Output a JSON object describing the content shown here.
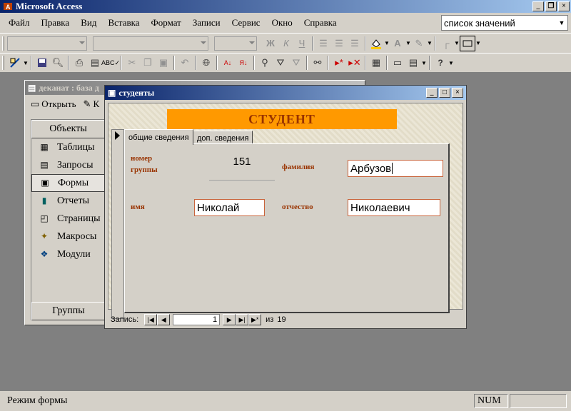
{
  "app": {
    "title": "Microsoft Access"
  },
  "menu": [
    "Файл",
    "Правка",
    "Вид",
    "Вставка",
    "Формат",
    "Записи",
    "Сервис",
    "Окно",
    "Справка"
  ],
  "ask_box": {
    "value": "список значений"
  },
  "db_window": {
    "title": "деканат : база д",
    "open_button": "Открыть",
    "design_button": "К",
    "objects_header": "Объекты",
    "groups_header": "Группы",
    "items": [
      {
        "label": "Таблицы",
        "icon": "table-icon"
      },
      {
        "label": "Запросы",
        "icon": "query-icon"
      },
      {
        "label": "Формы",
        "icon": "form-icon",
        "selected": true
      },
      {
        "label": "Отчеты",
        "icon": "report-icon"
      },
      {
        "label": "Страницы",
        "icon": "page-icon"
      },
      {
        "label": "Макросы",
        "icon": "macro-icon"
      },
      {
        "label": "Модули",
        "icon": "module-icon"
      }
    ]
  },
  "form_window": {
    "title": "студенты",
    "header": "СТУДЕНТ",
    "tabs": [
      "общие сведения",
      "доп. сведения"
    ],
    "fields": {
      "group_label_line1": "номер",
      "group_label_line2": "группы",
      "group_value": "151",
      "surname_label": "фамилия",
      "surname_value": "Арбузов",
      "name_label": "имя",
      "name_value": "Николай",
      "patronymic_label": "отчество",
      "patronymic_value": "Николаевич"
    },
    "nav": {
      "label": "Запись:",
      "current": "1",
      "of_label": "из",
      "total": "19"
    }
  },
  "status": {
    "text": "Режим формы",
    "num": "NUM"
  }
}
